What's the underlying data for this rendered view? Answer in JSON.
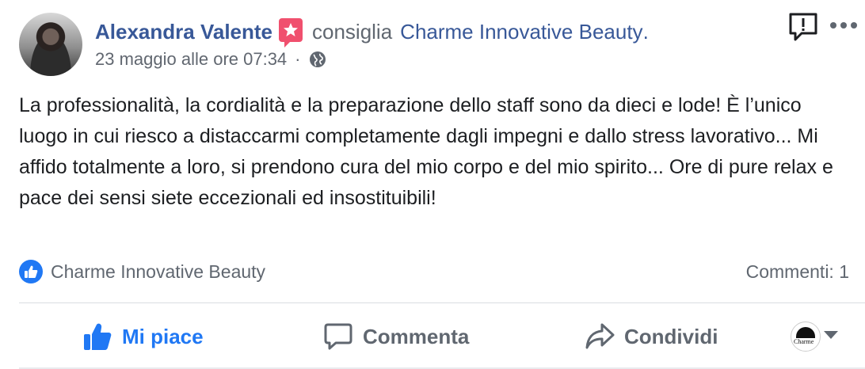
{
  "post": {
    "author": "Alexandra Valente",
    "action_text": "consiglia",
    "page_name": "Charme Innovative Beauty",
    "page_name_suffix": ".",
    "timestamp": "23 maggio alle ore 07:34",
    "separator": "·",
    "privacy_icon": "globe-icon",
    "text": "La professionalità, la cordialità e la preparazione dello staff sono da dieci e lode! È l’unico luogo in cui riesco a distaccarmi completamente dagli impegni e dallo stress lavorativo... Mi affido totalmente a loro, si prendono cura del mio corpo e del mio spirito... Ore di pure relax e pace dei sensi siete eccezionali ed insostituibili!"
  },
  "reactions": {
    "icon": "like-icon",
    "names": "Charme Innovative Beauty",
    "comments": "Commenti: 1"
  },
  "actions": {
    "like_label": "Mi piace",
    "comment_label": "Commenta",
    "share_label": "Condividi"
  },
  "page_avatar": {
    "text": "Charme"
  },
  "colors": {
    "link": "#385898",
    "like_blue": "#2078f4",
    "badge_pink": "#f0506e",
    "muted": "#606770"
  }
}
